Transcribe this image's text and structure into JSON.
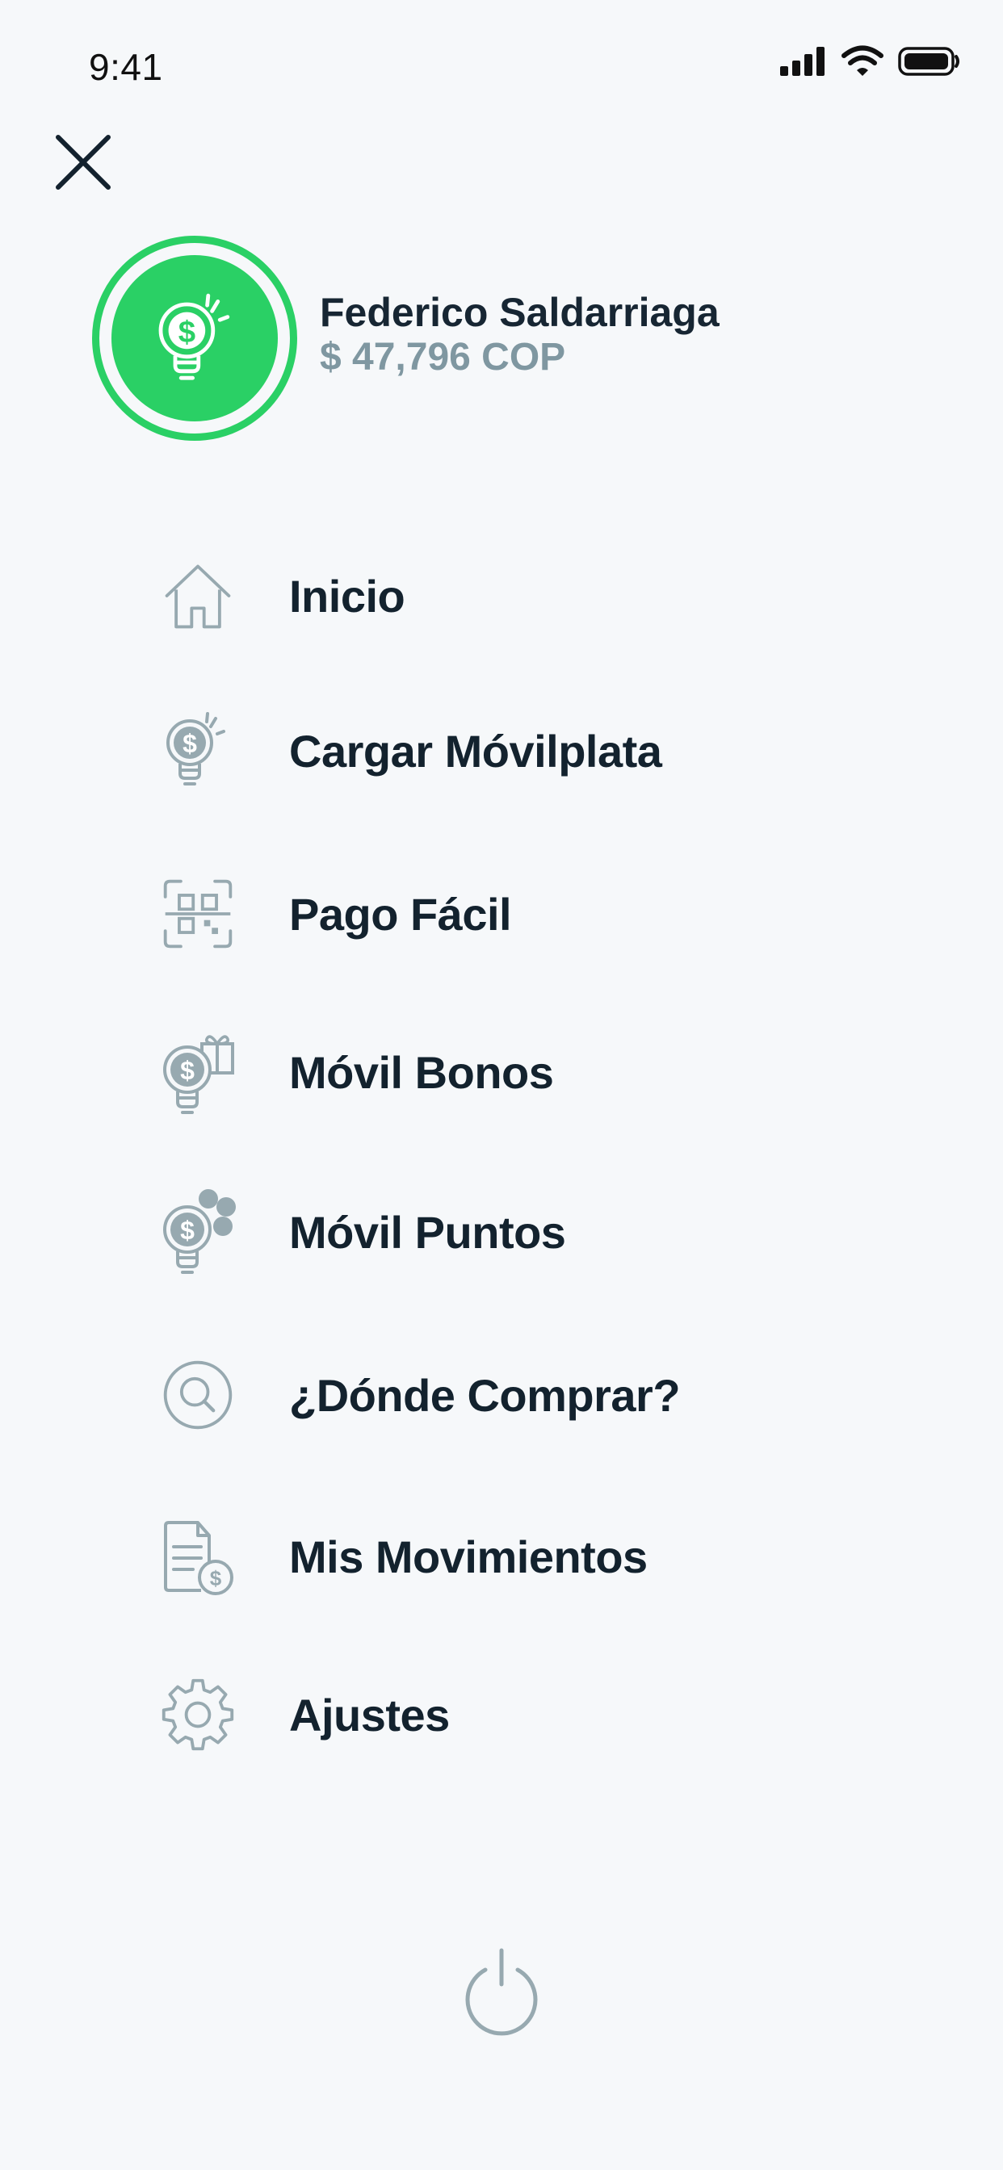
{
  "status_bar": {
    "time": "9:41"
  },
  "profile": {
    "name": "Federico Saldarriaga",
    "balance": "$ 47,796 COP"
  },
  "menu": {
    "items": [
      {
        "label": "Inicio",
        "icon": "home-icon"
      },
      {
        "label": "Cargar Móvilplata",
        "icon": "money-bulb-icon"
      },
      {
        "label": "Pago Fácil",
        "icon": "qr-scan-icon"
      },
      {
        "label": "Móvil Bonos",
        "icon": "gift-bulb-icon"
      },
      {
        "label": "Móvil Puntos",
        "icon": "points-bulb-icon"
      },
      {
        "label": "¿Dónde Comprar?",
        "icon": "search-icon"
      },
      {
        "label": "Mis Movimientos",
        "icon": "transactions-icon"
      },
      {
        "label": "Ajustes",
        "icon": "gear-icon"
      }
    ]
  },
  "colors": {
    "accent": "#2ad065",
    "icon_gray": "#97a9b0",
    "text_dark": "#13222e",
    "balance_gray": "#7f97a1",
    "background": "#f6f8fa"
  }
}
